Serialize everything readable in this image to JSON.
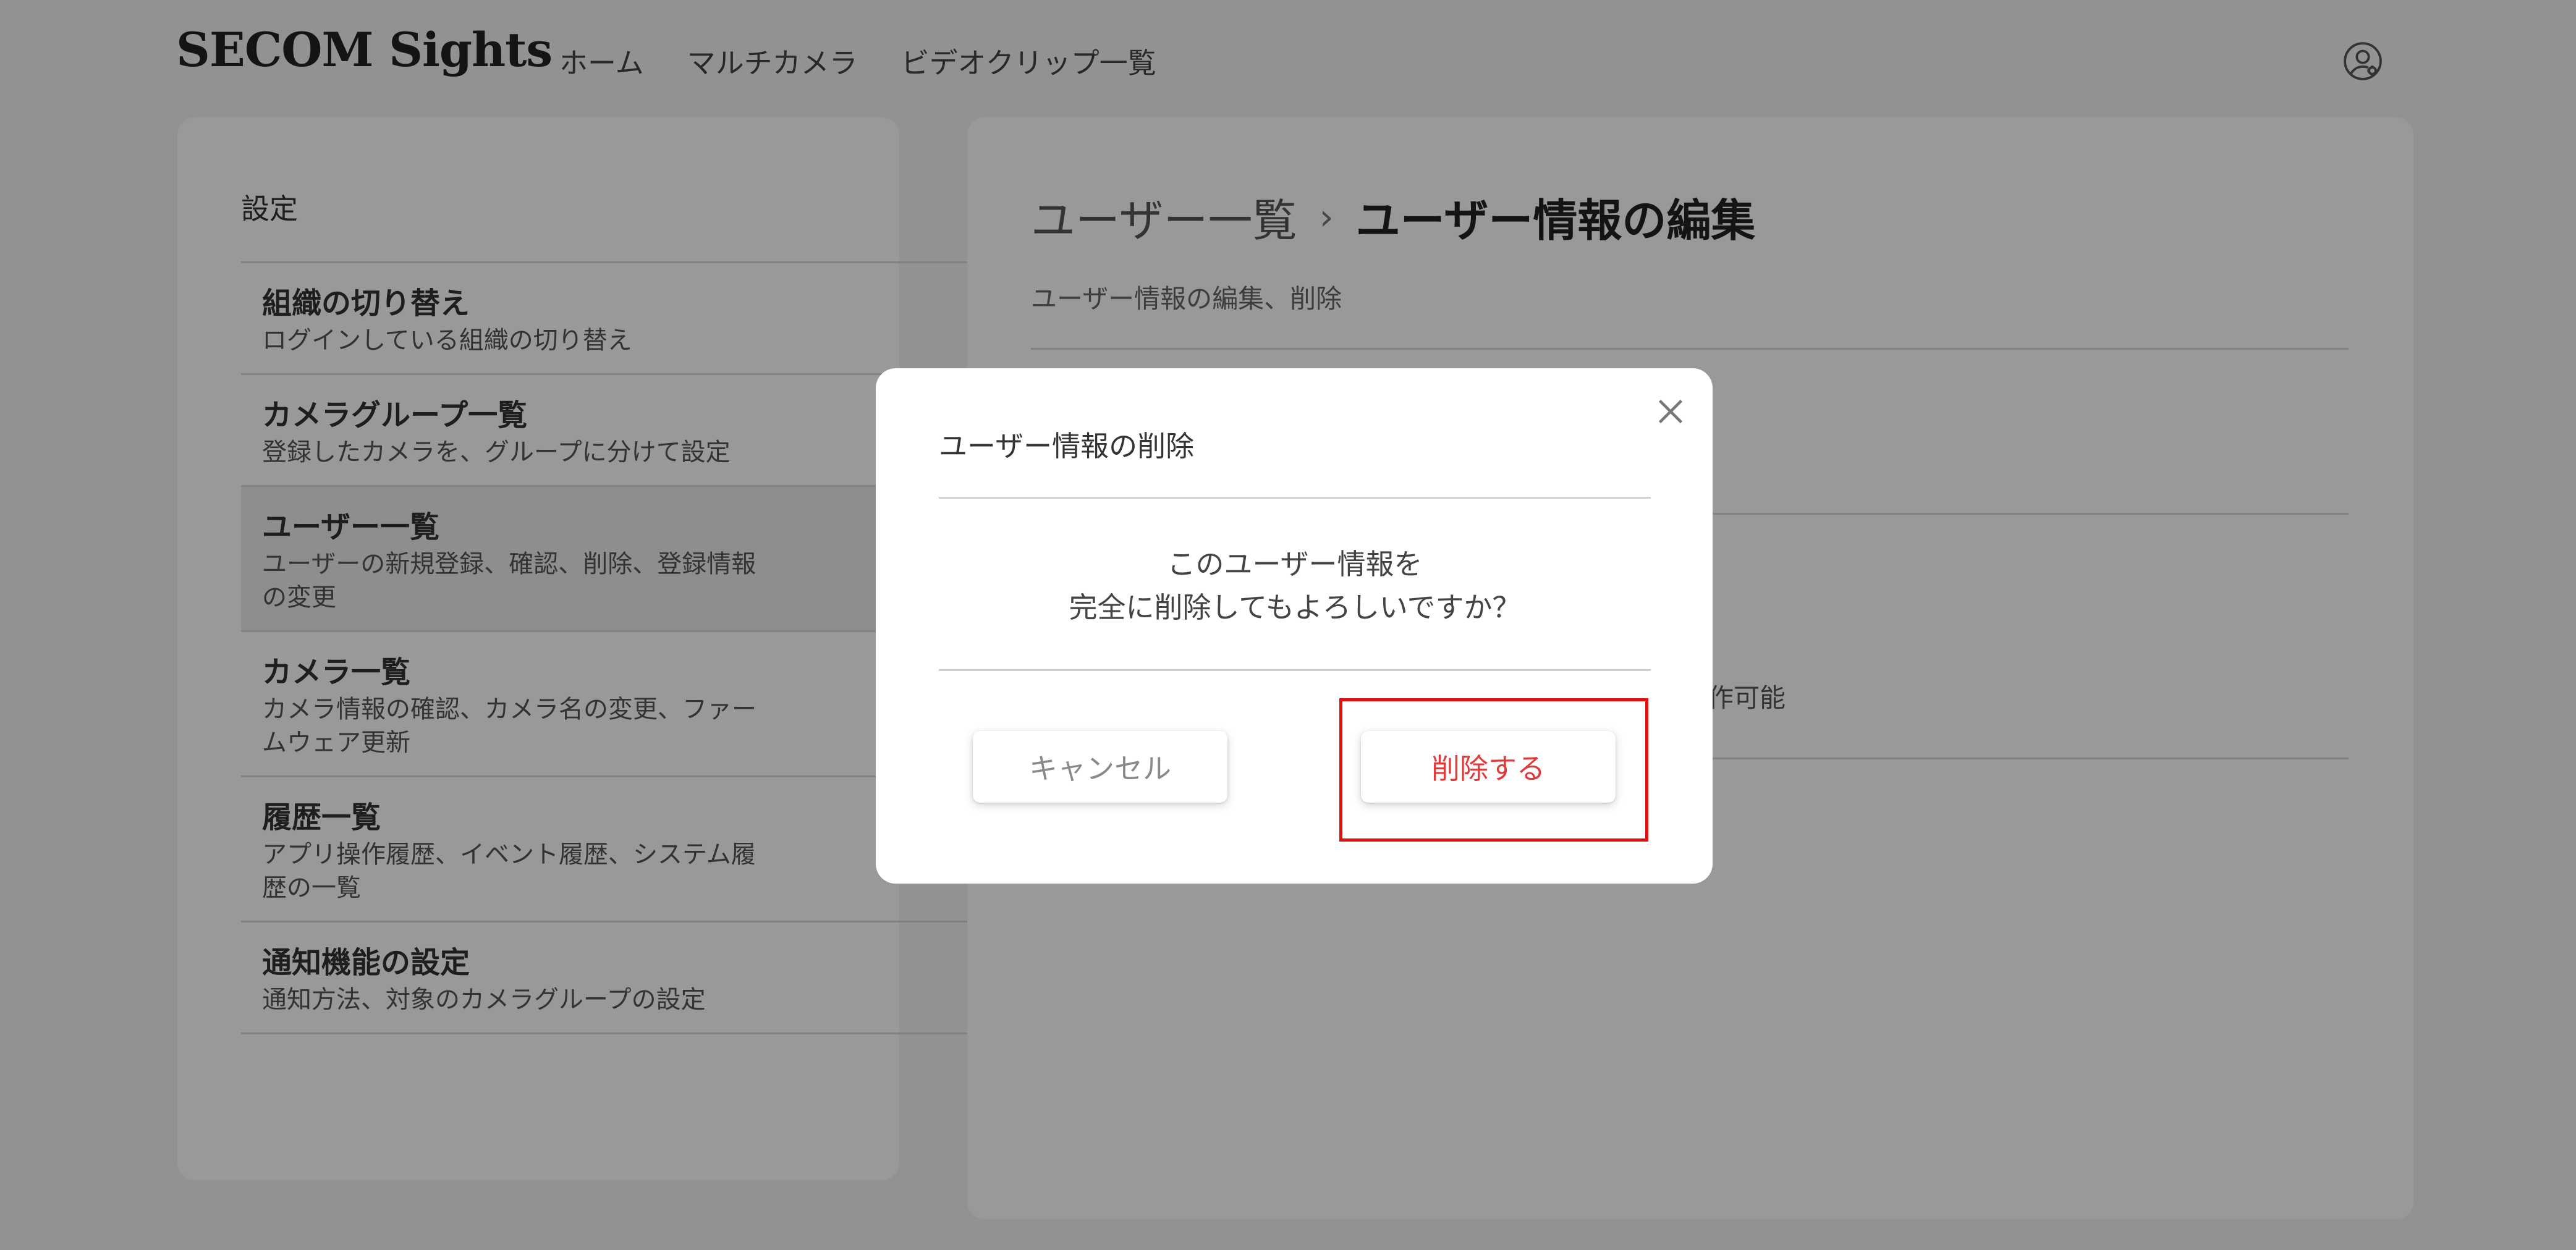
{
  "header": {
    "logo": "SECOM Sights",
    "nav": [
      "ホーム",
      "マルチカメラ",
      "ビデオクリップ一覧"
    ],
    "account_icon": "user-gear-icon"
  },
  "sidebar": {
    "title": "設定",
    "items": [
      {
        "title": "組織の切り替え",
        "desc": "ログインしている組織の切り替え"
      },
      {
        "title": "カメラグループ一覧",
        "desc": "登録したカメラを、グループに分けて設定"
      },
      {
        "title": "ユーザー一覧",
        "desc": "ユーザーの新規登録、確認、削除、登録情報の変更"
      },
      {
        "title": "カメラ一覧",
        "desc": "カメラ情報の確認、カメラ名の変更、ファームウェア更新"
      },
      {
        "title": "履歴一覧",
        "desc": "アプリ操作履歴、イベント履歴、システム履歴の一覧"
      },
      {
        "title": "通知機能の設定",
        "desc": "通知方法、対象のカメラグループの設定"
      }
    ],
    "active_index": 2
  },
  "main": {
    "breadcrumb_parent": "ユーザー一覧",
    "breadcrumb_separator": "›",
    "breadcrumb_current": "ユーザー情報の編集",
    "subtitle": "ユーザー情報の編集、削除",
    "partial_field_text": "作可能"
  },
  "dialog": {
    "title": "ユーザー情報の削除",
    "message_line1": "このユーザー情報を",
    "message_line2": "完全に削除してもよろしいですか？",
    "cancel_label": "キャンセル",
    "delete_label": "削除する",
    "close_icon": "close-icon"
  },
  "colors": {
    "delete_text": "#e03a3a",
    "highlight": "#e01010",
    "overlay": "rgba(0,0,0,0.40)"
  }
}
